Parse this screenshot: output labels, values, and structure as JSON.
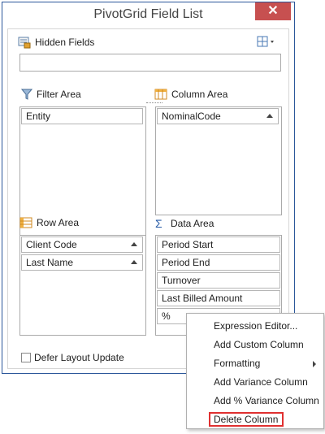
{
  "window": {
    "title": "PivotGrid Field List",
    "close_label": "✕"
  },
  "hidden_fields": {
    "label": "Hidden Fields"
  },
  "filter_area": {
    "label": "Filter Area",
    "fields": [
      "Entity"
    ]
  },
  "column_area": {
    "label": "Column Area",
    "fields": [
      "NominalCode"
    ]
  },
  "row_area": {
    "label": "Row Area",
    "fields": [
      "Client Code",
      "Last Name"
    ]
  },
  "data_area": {
    "label": "Data Area",
    "fields": [
      "Period Start",
      "Period End",
      "Turnover",
      "Last Billed Amount",
      "%"
    ]
  },
  "defer": {
    "label": "Defer Layout Update",
    "checked": false
  },
  "context_menu": {
    "items": [
      "Expression Editor...",
      "Add Custom Column",
      "Formatting",
      "Add Variance Column",
      "Add % Variance Column",
      "Delete Column"
    ]
  },
  "colors": {
    "close_red": "#c75050",
    "border_blue": "#2b579a",
    "highlight_red": "#e03030"
  },
  "icons": [
    "hidden-fields-icon",
    "layout-icon",
    "filter-icon",
    "column-area-icon",
    "row-area-icon",
    "sigma-icon"
  ]
}
